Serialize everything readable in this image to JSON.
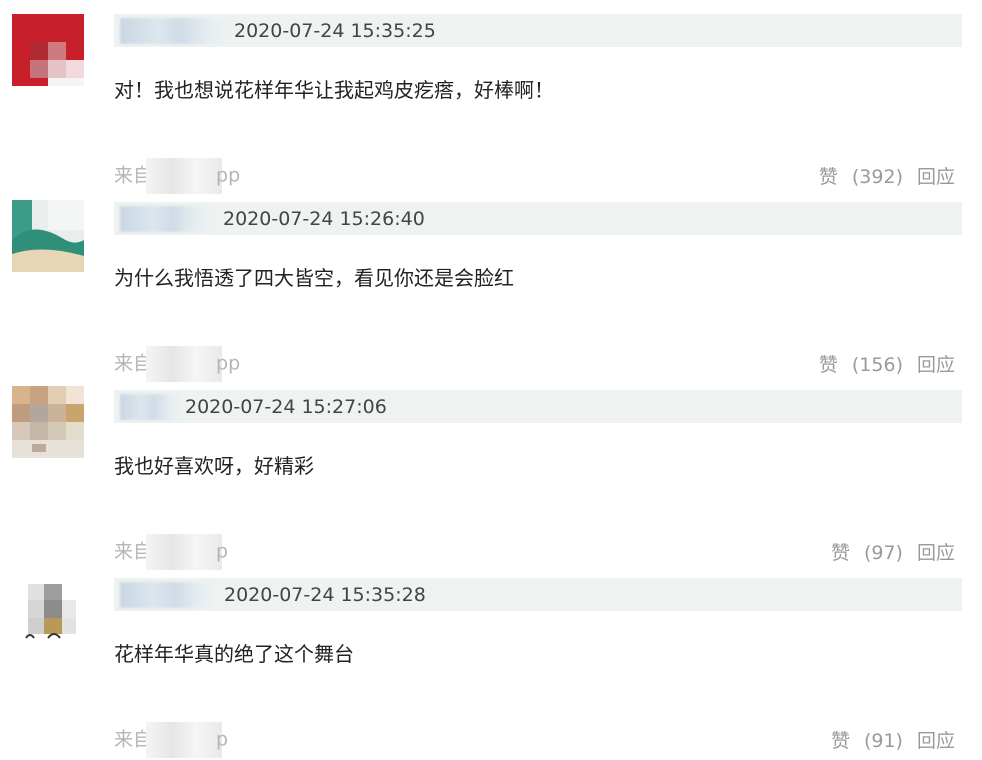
{
  "comments": [
    {
      "timestamp": "2020-07-24 15:35:25",
      "text": "对！我也想说花样年华让我起鸡皮疙瘩，好棒啊！",
      "source_prefix": "来自",
      "source_suffix": "pp",
      "like_label": "赞",
      "like_count": "(392)",
      "reply_label": "回应"
    },
    {
      "timestamp": "2020-07-24 15:26:40",
      "text": "为什么我悟透了四大皆空，看见你还是会脸红",
      "source_prefix": "来自",
      "source_suffix": "pp",
      "like_label": "赞",
      "like_count": "(156)",
      "reply_label": "回应"
    },
    {
      "timestamp": "2020-07-24 15:27:06",
      "text": "我也好喜欢呀，好精彩",
      "source_prefix": "来自",
      "source_suffix": "p",
      "like_label": "赞",
      "like_count": "(97)",
      "reply_label": "回应"
    },
    {
      "timestamp": "2020-07-24 15:35:28",
      "text": "花样年华真的绝了这个舞台",
      "source_prefix": "来自",
      "source_suffix": "p",
      "like_label": "赞",
      "like_count": "(91)",
      "reply_label": "回应"
    }
  ]
}
